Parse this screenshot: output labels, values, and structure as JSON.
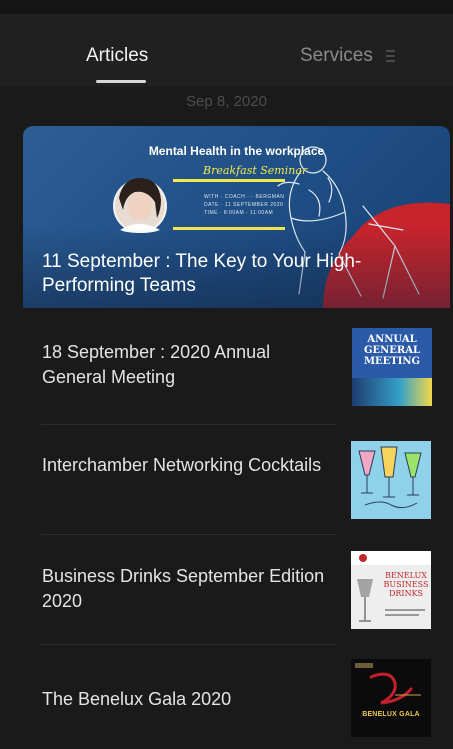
{
  "tabs": {
    "articles_label": "Articles",
    "services_label": "Services"
  },
  "feed": {
    "date": "Sep 8, 2020",
    "featured": {
      "title": "11 September : The Key to Your High-Performing Teams",
      "banner_heading": "Mental Health in the workplace",
      "banner_subheading": "Breakfast Seminar",
      "banner_details": [
        "WITH · COACH ··· BERGMAN",
        "DATE · 11 SEPTEMBER 2020",
        "TIME · 8:00AM - 11:00AM"
      ]
    },
    "items": [
      {
        "title": "18 September : 2020 Annual General Meeting",
        "thumb_text": "ANNUAL GENERAL MEETING"
      },
      {
        "title": "Interchamber Networking Cocktails"
      },
      {
        "title": "Business Drinks September Edition 2020",
        "thumb_text": "BENELUX BUSINESS DRINKS"
      },
      {
        "title": "The Benelux Gala 2020",
        "thumb_text": "BENELUX GALA"
      }
    ]
  },
  "colors": {
    "background": "#1a1a1a",
    "tab_bar": "#202020",
    "featured_blue": "#1f4e85",
    "banner_yellow": "#f4e84a",
    "accent_red": "#c0282a"
  },
  "icons": {
    "tab_overflow": "menu-lines-icon"
  }
}
